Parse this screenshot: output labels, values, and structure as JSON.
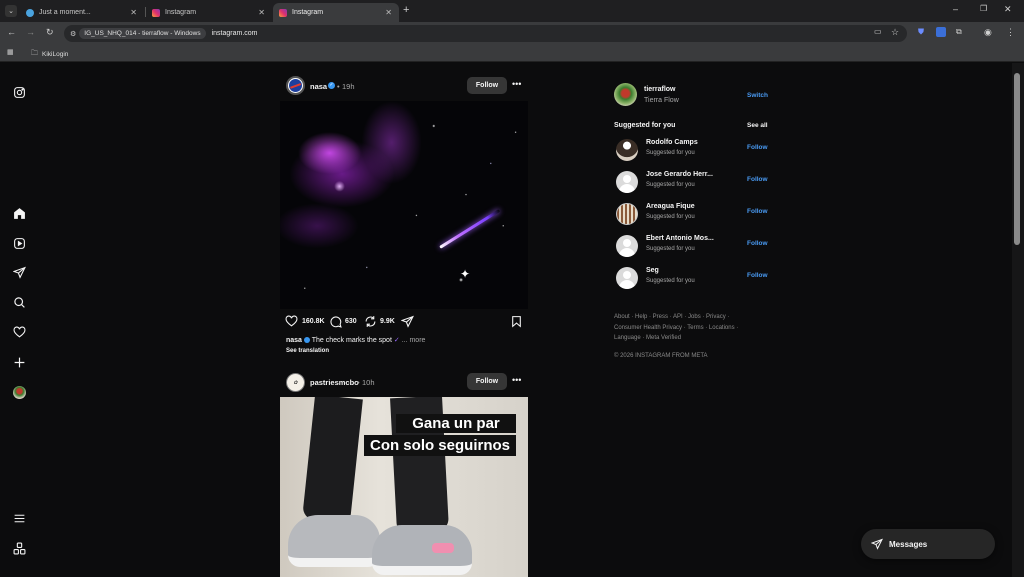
{
  "browser": {
    "tabs": [
      {
        "title": "Just a moment...",
        "active": false
      },
      {
        "title": "Instagram",
        "active": false
      },
      {
        "title": "Instagram",
        "active": true
      }
    ],
    "new_tab_label": "+",
    "profile_chip": "IG_US_NHQ_014 - tierraflow - Windows",
    "url": "instagram.com",
    "bookmark": "KikiLogin"
  },
  "sidebar": {
    "items": [
      "instagram-logo",
      "home",
      "reels",
      "explore-messages",
      "search",
      "notifications",
      "create",
      "profile",
      "more-menu",
      "also-from-meta"
    ]
  },
  "feed": {
    "posts": [
      {
        "username": "nasa",
        "verified": true,
        "dot": "•",
        "time": "19h",
        "follow_label": "Follow",
        "likes": "160.8K",
        "comments": "630",
        "reposts": "9.9K",
        "caption_user": "nasa",
        "caption_text": "The check marks the spot",
        "more_label": "... more",
        "see_translation": "See translation"
      },
      {
        "username": "pastriesmcbo",
        "verified": false,
        "dot": "•",
        "time": "10h",
        "follow_label": "Follow",
        "overlay_line1": "Gana un par",
        "overlay_line2": "Con solo seguirnos"
      }
    ]
  },
  "account": {
    "username": "tierraflow",
    "full_name": "Tierra Flow",
    "switch_label": "Switch"
  },
  "suggestions": {
    "title": "Suggested for you",
    "see_all": "See all",
    "items": [
      {
        "name": "Rodolfo Camps",
        "sub": "Suggested for you",
        "follow": "Follow"
      },
      {
        "name": "Jose Gerardo Herr...",
        "sub": "Suggested for you",
        "follow": "Follow"
      },
      {
        "name": "Areagua Fique",
        "sub": "Suggested for you",
        "follow": "Follow"
      },
      {
        "name": "Ebert Antonio Mos...",
        "sub": "Suggested for you",
        "follow": "Follow"
      },
      {
        "name": "Seg",
        "sub": "Suggested for you",
        "follow": "Follow"
      }
    ]
  },
  "footer": {
    "line1": "About · Help · Press · API · Jobs · Privacy ·",
    "line2": "Consumer Health Privacy · Terms · Locations ·",
    "line3": "Language · Meta Verified",
    "copyright": "© 2026 INSTAGRAM FROM META"
  },
  "messages_label": "Messages",
  "colors": {
    "accent": "#4a9cf5",
    "background": "#0c0c0d",
    "button": "#363636"
  }
}
